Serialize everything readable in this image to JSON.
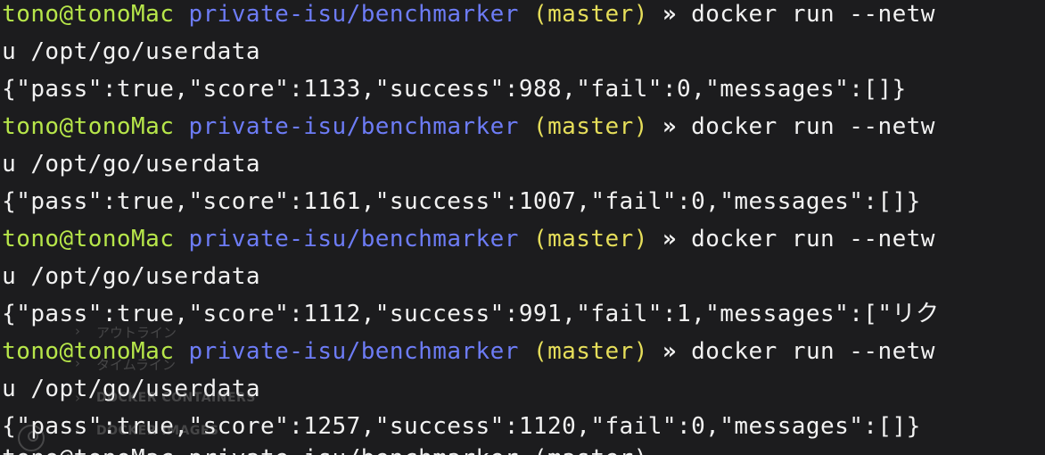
{
  "terminal": {
    "prompt": {
      "user": "tono@tonoMac",
      "path": "private-isu/benchmarker",
      "branch": "(master)",
      "separator": "»",
      "command": "docker run --netw",
      "lead_glyph": "❯"
    },
    "continuation": "u /opt/go/userdata",
    "results": [
      "{\"pass\":true,\"score\":1133,\"success\":988,\"fail\":0,\"messages\":[]}",
      "{\"pass\":true,\"score\":1161,\"success\":1007,\"fail\":0,\"messages\":[]}",
      "{\"pass\":true,\"score\":1112,\"success\":991,\"fail\":1,\"messages\":[\"リク",
      "{\"pass\":true,\"score\":1257,\"success\":1120,\"fail\":0,\"messages\":[]}"
    ],
    "partial_last_line": "tono@tonoMac private-isu/benchmarker (master)"
  },
  "overlay": {
    "items": [
      "アウトライン",
      "タイムライン",
      "DOCKER CONTAINERS",
      "DOCKER IMAGES"
    ],
    "chevron": "›"
  },
  "colors": {
    "background": "#1c1c1e",
    "user": "#b7e64a",
    "path": "#6d7cf6",
    "branch": "#e6de5a",
    "text": "#f2f2f2"
  }
}
